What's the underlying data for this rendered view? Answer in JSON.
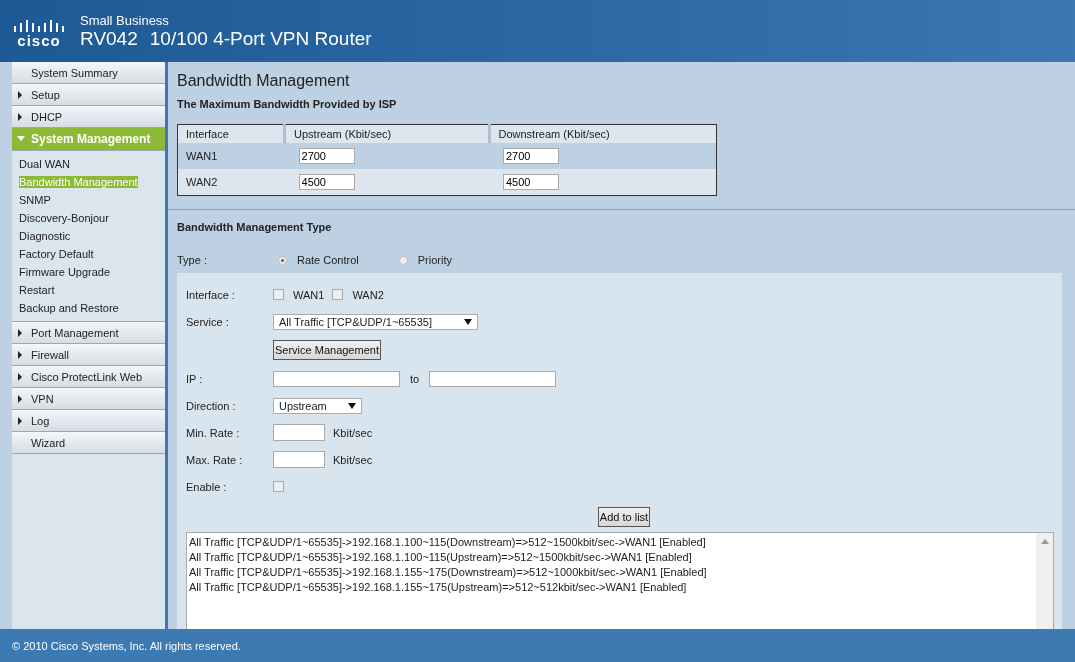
{
  "header": {
    "logo_text": "cisco",
    "product_line": "Small Business",
    "model": "RV042",
    "title": "10/100 4-Port VPN Router"
  },
  "sidebar": {
    "items": [
      {
        "label": "System Summary",
        "expandable": false,
        "selected": false
      },
      {
        "label": "Setup",
        "expandable": true,
        "expanded": false,
        "selected": false
      },
      {
        "label": "DHCP",
        "expandable": true,
        "expanded": false,
        "selected": false
      },
      {
        "label": "System Management",
        "expandable": true,
        "expanded": true,
        "selected": true,
        "children": [
          {
            "label": "Dual WAN",
            "selected": false
          },
          {
            "label": "Bandwidth Management",
            "selected": true
          },
          {
            "label": "SNMP",
            "selected": false
          },
          {
            "label": "Discovery-Bonjour",
            "selected": false
          },
          {
            "label": "Diagnostic",
            "selected": false
          },
          {
            "label": "Factory Default",
            "selected": false
          },
          {
            "label": "Firmware Upgrade",
            "selected": false
          },
          {
            "label": "Restart",
            "selected": false
          },
          {
            "label": "Backup and Restore",
            "selected": false
          }
        ]
      },
      {
        "label": "Port Management",
        "expandable": true,
        "expanded": false,
        "selected": false
      },
      {
        "label": "Firewall",
        "expandable": true,
        "expanded": false,
        "selected": false
      },
      {
        "label": "Cisco ProtectLink Web",
        "expandable": true,
        "expanded": false,
        "selected": false
      },
      {
        "label": "VPN",
        "expandable": true,
        "expanded": false,
        "selected": false
      },
      {
        "label": "Log",
        "expandable": true,
        "expanded": false,
        "selected": false
      },
      {
        "label": "Wizard",
        "expandable": false,
        "selected": false
      }
    ]
  },
  "page_title": "Bandwidth Management",
  "isp": {
    "heading": "The Maximum Bandwidth Provided by ISP",
    "columns": [
      "Interface",
      "Upstream (Kbit/sec)",
      "Downstream (Kbit/sec)"
    ],
    "rows": [
      {
        "interface": "WAN1",
        "upstream": "2700",
        "downstream": "2700"
      },
      {
        "interface": "WAN2",
        "upstream": "4500",
        "downstream": "4500"
      }
    ]
  },
  "type_section": {
    "heading": "Bandwidth Management Type",
    "label": "Type :",
    "options": [
      {
        "label": "Rate Control",
        "selected": true
      },
      {
        "label": "Priority",
        "selected": false
      }
    ]
  },
  "form": {
    "interface_label": "Interface :",
    "interfaces": [
      {
        "label": "WAN1",
        "checked": false
      },
      {
        "label": "WAN2",
        "checked": false
      }
    ],
    "service_label": "Service :",
    "service_value": "All Traffic [TCP&UDP/1~65535]",
    "service_management_button": "Service Management",
    "ip_label": "IP :",
    "ip_to": "to",
    "direction_label": "Direction :",
    "direction_value": "Upstream",
    "min_rate_label": "Min. Rate :",
    "max_rate_label": "Max. Rate :",
    "rate_unit_min": "Kbit/sec",
    "rate_unit_max": "Kbit/sec",
    "enable_label": "Enable :",
    "enable_checked": false,
    "add_button": "Add to list",
    "entries": [
      "All Traffic [TCP&UDP/1~65535]->192.168.1.100~115(Downstream)=>512~1500kbit/sec->WAN1 [Enabled]",
      "All Traffic [TCP&UDP/1~65535]->192.168.1.100~115(Upstream)=>512~1500kbit/sec->WAN1 [Enabled]",
      "All Traffic [TCP&UDP/1~65535]->192.168.1.155~175(Downstream)=>512~1000kbit/sec->WAN1 [Enabled]",
      "All Traffic [TCP&UDP/1~65535]->192.168.1.155~175(Upstream)=>512~512kbit/sec->WAN1 [Enabled]"
    ]
  },
  "footer": "© 2010 Cisco Systems, Inc. All rights reserved."
}
